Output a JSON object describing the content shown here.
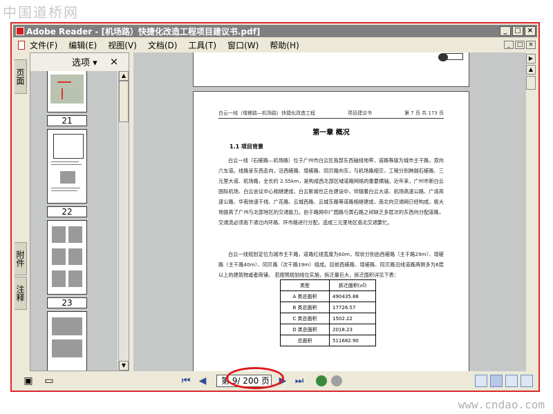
{
  "watermarks": {
    "top": "中国道桥网",
    "bottom": "www.cndao.com"
  },
  "window": {
    "title": "Adobe Reader - [机场路）快捷化改造工程项目建议书.pdf]",
    "min": "_",
    "max": "□",
    "close": "×"
  },
  "menu": {
    "items": [
      "文件(F)",
      "编辑(E)",
      "视图(V)",
      "文档(D)",
      "工具(T)",
      "窗口(W)",
      "帮助(H)"
    ]
  },
  "left_tabs": {
    "pages": "页面",
    "attachments": "附件",
    "comments": "注释"
  },
  "panel": {
    "options": "选项",
    "options_arrow": "▾",
    "close": "×"
  },
  "thumbnails": {
    "labels": [
      "21",
      "22",
      "23"
    ]
  },
  "document": {
    "header_left": "白云一线（增槎路—机场路）快捷化改造工程",
    "header_mid": "项目建议书",
    "header_right": "第 7 页 共 173 页",
    "chapter": "第一章 概况",
    "section": "1.1 项目背景",
    "para1": "白云一线（石槎路—机场路）位于广州市白云区南部东西轴线地带，道路等级为城市主干路，双向六车道。线路呈东西走向，沿西槎路、增槎路、同贝路向东，与机场路相交，工程分别跨越石槎路、三元里大道、机场路，全长约 2.55km，是构成西北部区域道路网络的重要横轴。近年来，广州市新白云国际机场、白云会议中心相继建成，白云新城也正在建设中，伴随着白云大道、机场高速公路、广清高速公路、华南快速干线、广花路、云城西路、云城东路等道路相继建成，南北向交通网已经构成，极大地提高了广州与北部地区的交通能力。由于路网中广园路与黄石路之间缺乏多层次的东西向分配道路，交通流必须南下通过内环路、环市路进行分配，造成三元里地区南北交通繁忙。",
    "para2": "白云一线规划定位为城市主干路，道路红线宽度为60m，现状分别由西槎路（主干路29m）、增槎路（主干路40m）、同贝路（次干路19m）组成。目前西槎路、增槎路、同贝路沿线道路两侧多为6层以上的建筑物或者商铺，  若按照规划线位实施，拆迁量巨大，拆迁面积详见下表：",
    "table": {
      "headers": [
        "类型",
        "拆迁面积(㎡)"
      ],
      "rows": [
        [
          "A 类总面积",
          "490435.88"
        ],
        [
          "B 类总面积",
          "17726.57"
        ],
        [
          "C 类总面积",
          "1502.22"
        ],
        [
          "D 类总面积",
          "2018.23"
        ],
        [
          "总面积",
          "511682.90"
        ]
      ]
    }
  },
  "status": {
    "page_indicator": "第 9/ 200 页"
  },
  "colors": {
    "highlight": "#e01818",
    "title_bar": "#7f7f7f",
    "nav_blue": "#2a4d9c"
  }
}
